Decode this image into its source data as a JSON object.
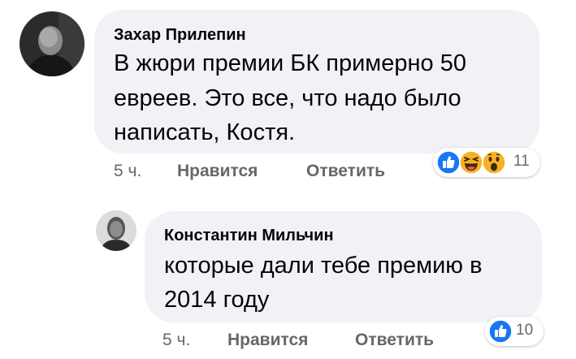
{
  "comments": [
    {
      "author": "Захар Прилепин",
      "text_lines": [
        "В жюри премии БК примерно 50",
        "евреев. Это все, что надо было",
        "написать, Костя."
      ],
      "time": "5 ч.",
      "like_label": "Нравится",
      "reply_label": "Ответить",
      "reactions": [
        "like-icon",
        "laughing-icon",
        "wow-icon"
      ],
      "reaction_count": "11"
    },
    {
      "author": "Константин Мильчин",
      "text_lines": [
        "которые дали тебе премию в",
        "2014 году"
      ],
      "time": "5 ч.",
      "like_label": "Нравится",
      "reply_label": "Ответить",
      "reactions": [
        "like-icon"
      ],
      "reaction_count": "10"
    }
  ],
  "colors": {
    "bubble": "#f0f2f5",
    "like_blue": "#1877f2",
    "emoji_yellow": "#f7b125",
    "meta_gray": "#65676b"
  }
}
